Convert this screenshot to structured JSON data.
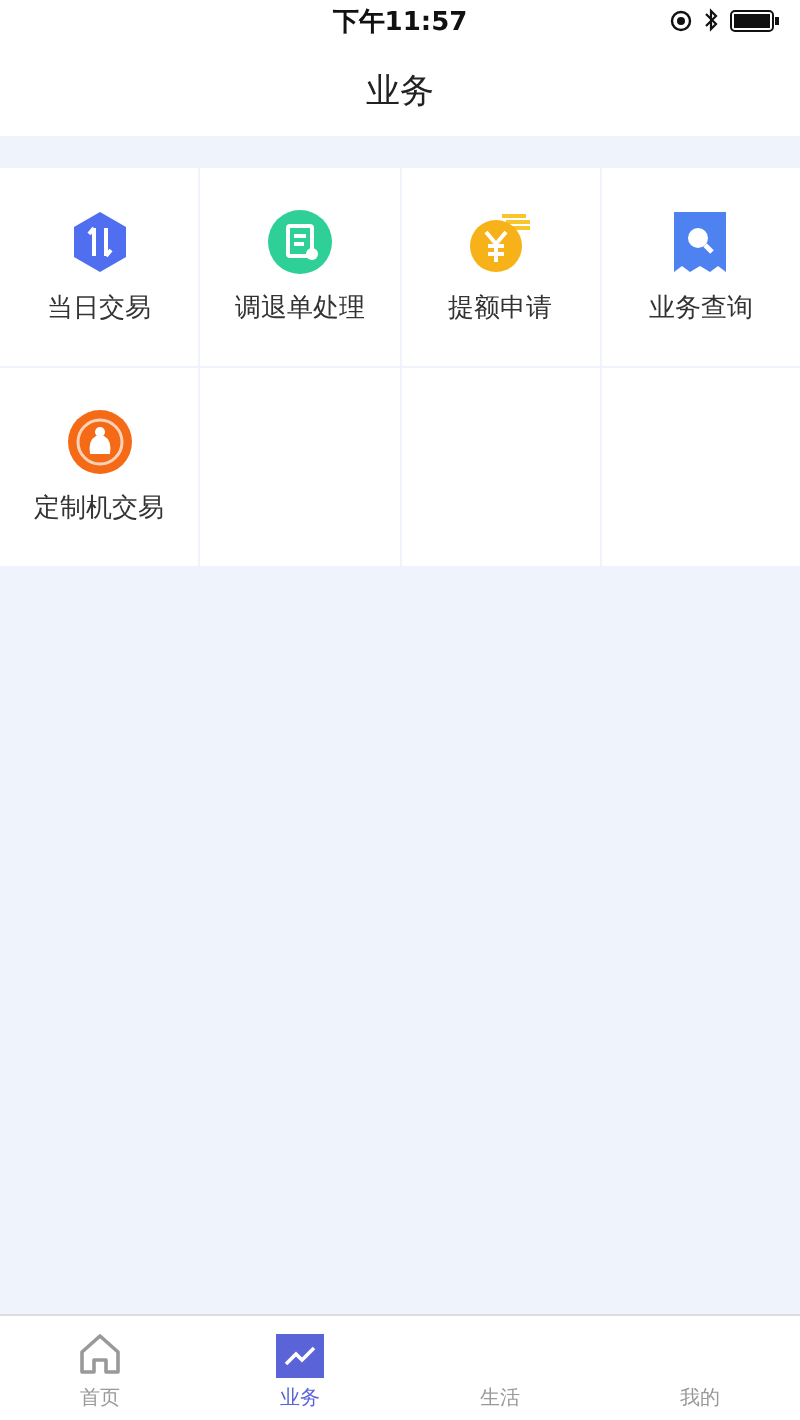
{
  "status_bar": {
    "time": "下午11:57"
  },
  "header": {
    "title": "业务"
  },
  "grid": [
    {
      "label": "当日交易"
    },
    {
      "label": "调退单处理"
    },
    {
      "label": "提额申请"
    },
    {
      "label": "业务查询"
    },
    {
      "label": "定制机交易"
    }
  ],
  "tab_bar": [
    {
      "label": "首页",
      "selected": false
    },
    {
      "label": "业务",
      "selected": true
    },
    {
      "label": "生活",
      "selected": false
    },
    {
      "label": "我的",
      "selected": false
    }
  ]
}
